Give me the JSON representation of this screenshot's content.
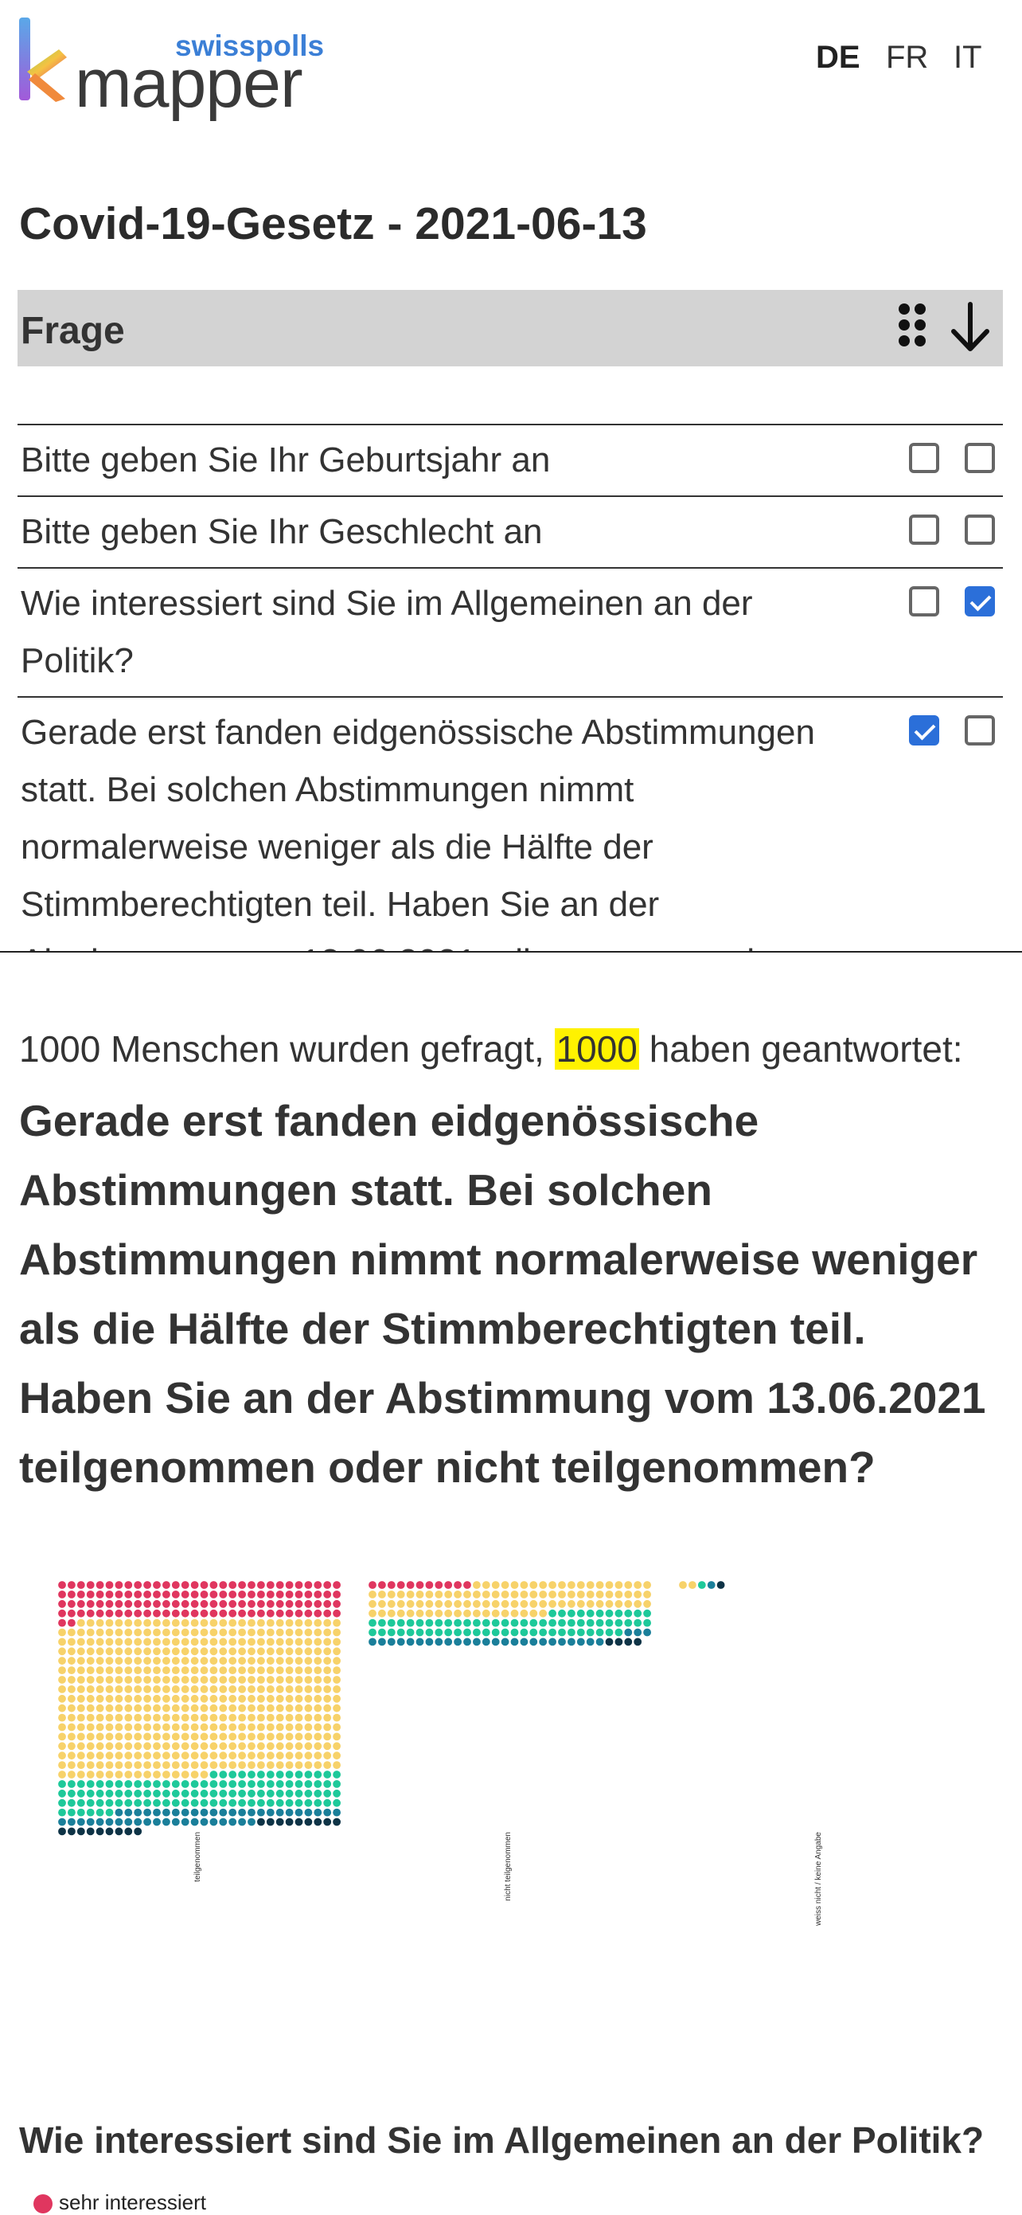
{
  "header": {
    "logo_word": "mapper",
    "logo_sub": "swisspolls",
    "languages": [
      {
        "label": "DE",
        "active": true
      },
      {
        "label": "FR",
        "active": false
      },
      {
        "label": "IT",
        "active": false
      }
    ]
  },
  "title": "Covid-19-Gesetz - 2021-06-13",
  "question_bar": {
    "label": "Frage",
    "icons": [
      "drag-dots-icon",
      "arrow-down-icon"
    ]
  },
  "questions": [
    {
      "text": "Bitte geben Sie Ihr Geburtsjahr an",
      "check_a": false,
      "check_b": false
    },
    {
      "text": "Bitte geben Sie Ihr Geschlecht an",
      "check_a": false,
      "check_b": false
    },
    {
      "text": "Wie interessiert sind Sie im Allgemeinen an der Politik?",
      "check_a": false,
      "check_b": true
    },
    {
      "text": "Gerade erst fanden eidgenössische Abstimmungen statt. Bei solchen Abstimmungen nimmt normalerweise weniger als die Hälfte der Stimmberechtigten teil. Haben Sie an der Abstimmung vom 13.06.2021 teilgenommen oder nicht teilgenommen?",
      "check_a": true,
      "check_b": false
    }
  ],
  "result": {
    "asked_text": "1000 Menschen wurden gefragt,",
    "answered_count": "1000",
    "answered_text": "haben geantwortet:",
    "question": "Gerade erst fanden eidgenössische Abstimmungen statt. Bei solchen Abstimmungen nimmt normalerweise weniger als die Hälfte der Stimmberechtigten teil. Haben Sie an der Abstimmung vom 13.06.2021 teilgenommen oder nicht teilgenommen?"
  },
  "chart_data": {
    "type": "waffle",
    "categories": [
      "teilgenommen",
      "nicht teilgenommen",
      "weiss nicht / keine Angabe"
    ],
    "series": [
      {
        "name": "sehr interessiert",
        "color": "#e0365f",
        "values": [
          122,
          11,
          0
        ]
      },
      {
        "name": "",
        "color": "#f7d26a",
        "values": [
          494,
          98,
          2
        ]
      },
      {
        "name": "",
        "color": "#1ec99a",
        "values": [
          110,
          68,
          1
        ]
      },
      {
        "name": "",
        "color": "#1a7f9a",
        "values": [
          45,
          28,
          1
        ]
      },
      {
        "name": "",
        "color": "#0e3346",
        "values": [
          18,
          4,
          1
        ]
      }
    ]
  },
  "question2": "Wie interessiert sind Sie im Allgemeinen an der Politik?",
  "legend": [
    {
      "label": "sehr interessiert",
      "color": "#e0365f"
    }
  ]
}
